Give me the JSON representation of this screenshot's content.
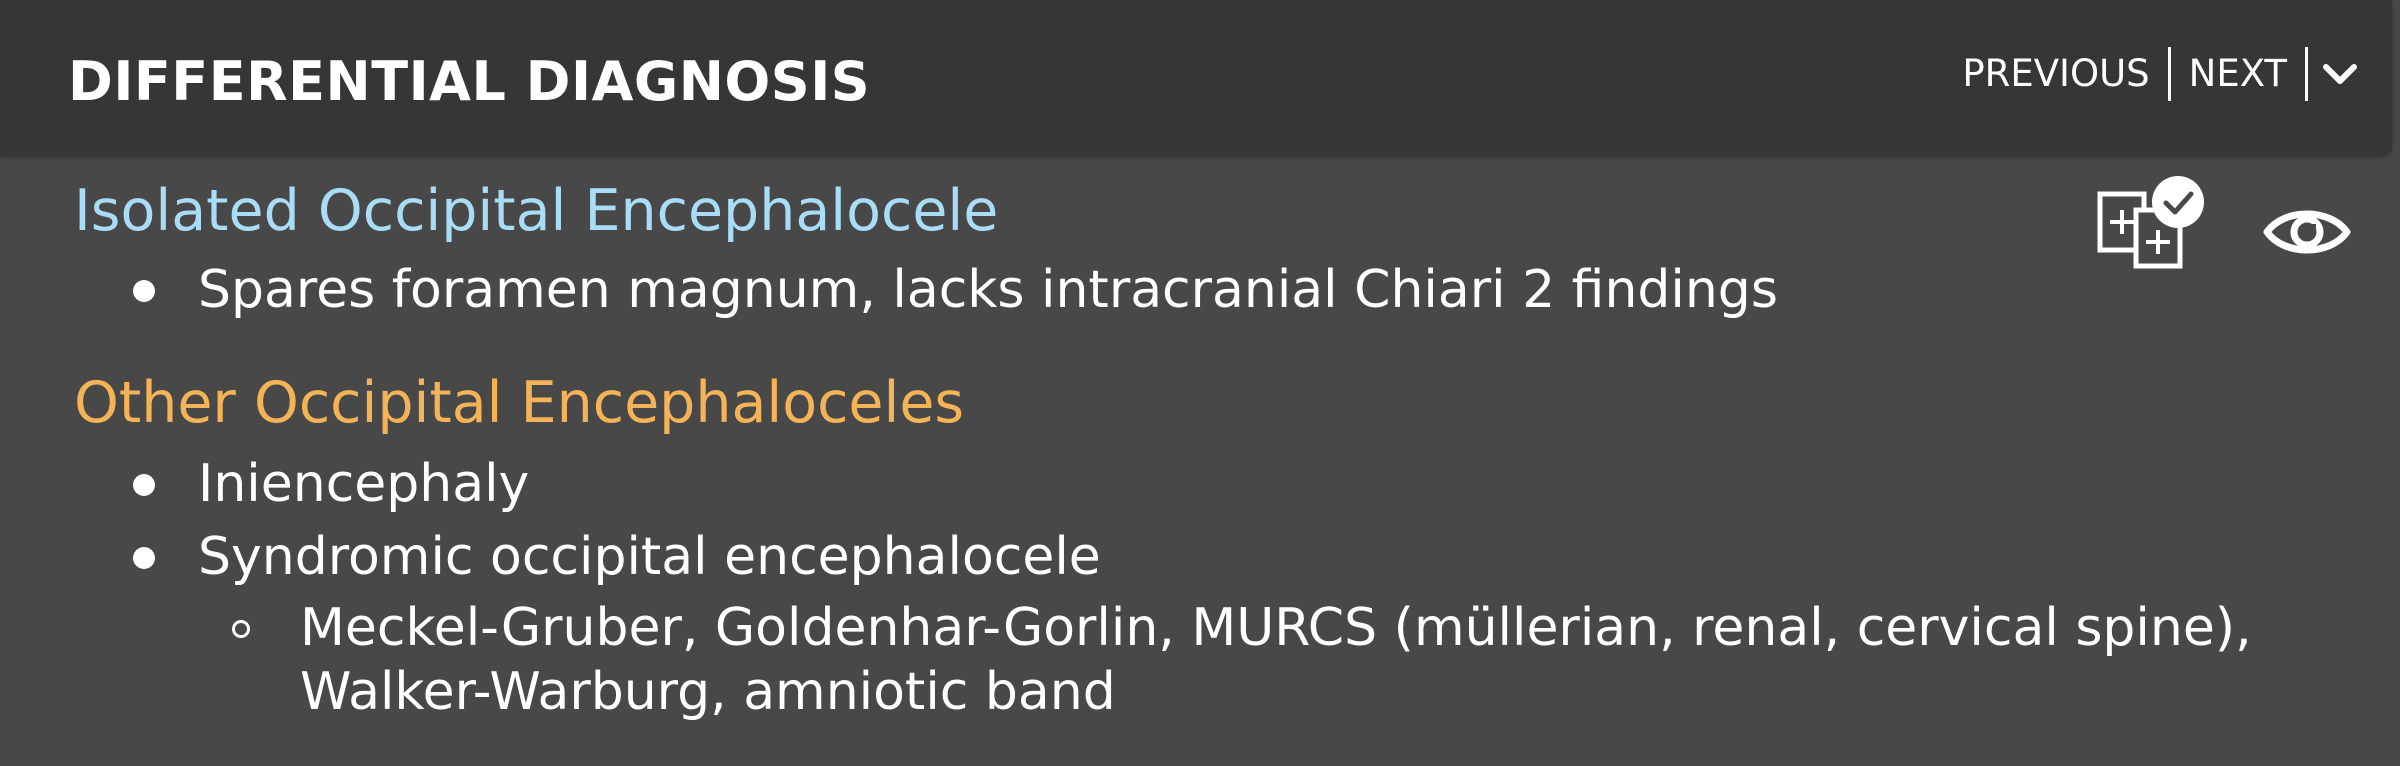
{
  "header": {
    "title": "DIFFERENTIAL DIAGNOSIS",
    "nav": {
      "previous": "PREVIOUS",
      "next": "NEXT"
    }
  },
  "sections": [
    {
      "heading": "Isolated Occipital Encephalocele",
      "color": "#a9dcf6",
      "items": [
        "Spares foramen magnum, lacks intracranial Chiari 2 findings"
      ]
    },
    {
      "heading": "Other Occipital Encephaloceles",
      "color": "#f5b358",
      "items": [
        "Iniencephaly",
        "Syndromic occipital encephalocele"
      ],
      "subitems": [
        "Meckel-Gruber, Goldenhar-Gorlin, MURCS (müllerian, renal, cervical spine),",
        "Walker-Warburg, amniotic band"
      ]
    }
  ],
  "icons": {
    "compare": "compare-checked-icon",
    "view": "eye-icon",
    "collapse": "chevron-down-icon"
  }
}
